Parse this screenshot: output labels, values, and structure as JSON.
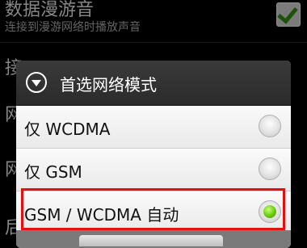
{
  "background": {
    "roaming_title": "数据漫游音",
    "roaming_summary": "连接到漫游网络时播放声音",
    "roaming_checked": true,
    "partial_row_text": "接",
    "partial_row2_text": "网",
    "partial_row3_text": "网",
    "partial_row4_text": "后"
  },
  "dialog": {
    "title": "首选网络模式",
    "options": [
      {
        "label": "仅 WCDMA",
        "selected": false
      },
      {
        "label": "仅 GSM",
        "selected": false
      },
      {
        "label": "GSM / WCDMA 自动",
        "selected": true
      }
    ]
  },
  "colors": {
    "highlight": "#e31010",
    "radio_on": "#6fcf13",
    "dialog_header": "#2b2b2b"
  }
}
